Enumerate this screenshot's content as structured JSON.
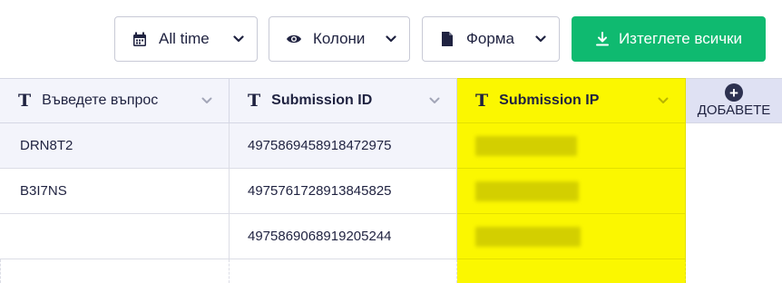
{
  "toolbar": {
    "time_label": "All time",
    "columns_label": "Колони",
    "form_label": "Форма",
    "download_label": "Изтеглете всички"
  },
  "colors": {
    "primary_green": "#0fba70",
    "highlight_yellow": "#fbf700",
    "header_bg": "#f3f4fb",
    "text_dark": "#1f2240"
  },
  "icons": {
    "time": "calendar-icon",
    "columns": "eye-icon",
    "form": "document-icon",
    "download": "download-icon",
    "column_type": "text-type-icon",
    "dropdown": "chevron-down-icon",
    "add": "plus-circle-icon"
  },
  "table": {
    "columns": [
      {
        "type_glyph": "T",
        "label": "Въведете въпрос"
      },
      {
        "type_glyph": "T",
        "label": "Submission ID"
      },
      {
        "type_glyph": "T",
        "label": "Submission IP"
      }
    ],
    "add_column_label": "ДОБАВЕТЕ",
    "rows": [
      {
        "answer": "DRN8T2",
        "submission_id": "4975869458918472975",
        "submission_ip": ""
      },
      {
        "answer": "B3I7NS",
        "submission_id": "4975761728913845825",
        "submission_ip": ""
      },
      {
        "answer": "",
        "submission_id": "4975869068919205244",
        "submission_ip": ""
      }
    ]
  }
}
